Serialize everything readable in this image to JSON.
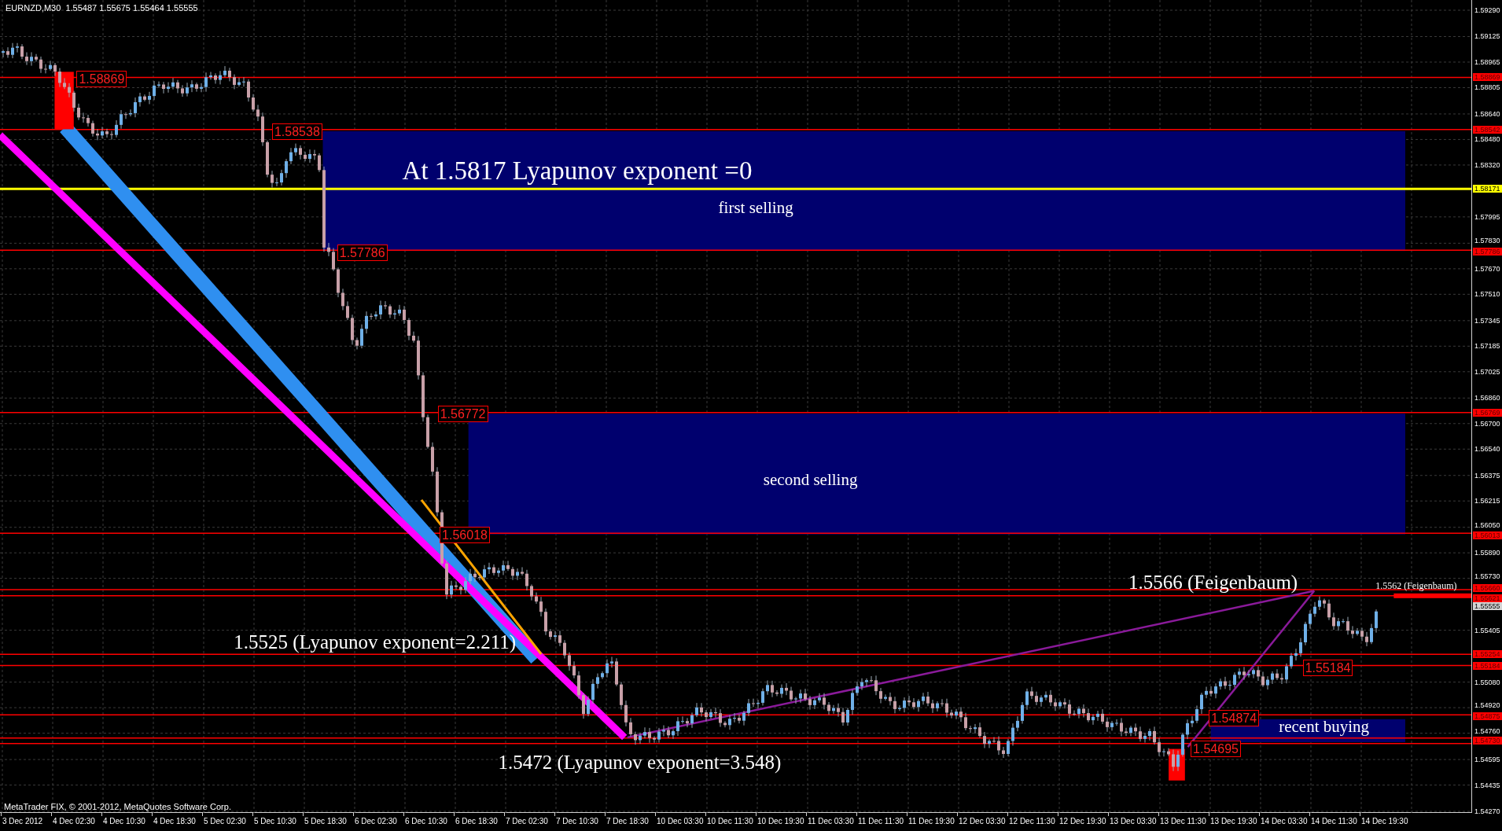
{
  "chart_header": "EURNZD,M30  1.55487 1.55675 1.55464 1.55555",
  "copyright": "MetaTrader FIX, © 2001-2012, MetaQuotes Software Corp.",
  "annotations": [
    {
      "kind": "heading",
      "text": "At 1.5817 Lyapunov exponent =0"
    },
    {
      "kind": "zone",
      "text": "first selling"
    },
    {
      "kind": "zone",
      "text": "second selling"
    },
    {
      "kind": "note",
      "text": "1.5566 (Feigenbaum)"
    },
    {
      "kind": "small",
      "text": "1.5562 (Feigenbaum)"
    },
    {
      "kind": "note",
      "text": "1.5525 (Lyapunov exponent=2.211)"
    },
    {
      "kind": "note",
      "text": "1.5472 (Lyapunov exponent=3.548)"
    },
    {
      "kind": "zone",
      "text": "recent buying"
    }
  ],
  "price_tags": [
    "1.58869",
    "1.58538",
    "1.57786",
    "1.56772",
    "1.56018",
    "1.55184",
    "1.54874",
    "1.54695"
  ],
  "price_axis": {
    "ticks": [
      "1.59290",
      "1.59125",
      "1.58965",
      "1.58805",
      "1.58640",
      "1.58480",
      "1.58320",
      "1.57995",
      "1.57830",
      "1.57670",
      "1.57510",
      "1.57345",
      "1.57185",
      "1.57025",
      "1.56860",
      "1.56700",
      "1.56540",
      "1.56375",
      "1.56215",
      "1.56050",
      "1.55890",
      "1.55730",
      "1.55405",
      "1.55080",
      "1.54920",
      "1.54760",
      "1.54595",
      "1.54435",
      "1.54270"
    ],
    "markers": [
      {
        "kind": "level",
        "label": "1.58869"
      },
      {
        "kind": "level",
        "label": "1.58542"
      },
      {
        "kind": "zero",
        "label": "1.58171"
      },
      {
        "kind": "level",
        "label": "1.57786"
      },
      {
        "kind": "level",
        "label": "1.56769"
      },
      {
        "kind": "level",
        "label": "1.56013"
      },
      {
        "kind": "level",
        "label": "1.55660"
      },
      {
        "kind": "level",
        "label": "1.55621"
      },
      {
        "kind": "bid",
        "label": "1.55555"
      },
      {
        "kind": "level",
        "label": "1.55254"
      },
      {
        "kind": "level",
        "label": "1.55184"
      },
      {
        "kind": "level",
        "label": "1.54875"
      },
      {
        "kind": "level",
        "label": "1.54730"
      }
    ]
  },
  "time_axis": [
    "3 Dec 2012",
    "4 Dec 02:30",
    "4 Dec 10:30",
    "4 Dec 18:30",
    "5 Dec 02:30",
    "5 Dec 10:30",
    "5 Dec 18:30",
    "6 Dec 02:30",
    "6 Dec 10:30",
    "6 Dec 18:30",
    "7 Dec 02:30",
    "7 Dec 10:30",
    "7 Dec 18:30",
    "10 Dec 03:30",
    "10 Dec 11:30",
    "10 Dec 19:30",
    "11 Dec 03:30",
    "11 Dec 11:30",
    "11 Dec 19:30",
    "12 Dec 03:30",
    "12 Dec 11:30",
    "12 Dec 19:30",
    "13 Dec 03:30",
    "13 Dec 11:30",
    "13 Dec 19:30",
    "14 Dec 03:30",
    "14 Dec 11:30",
    "14 Dec 19:30"
  ]
}
